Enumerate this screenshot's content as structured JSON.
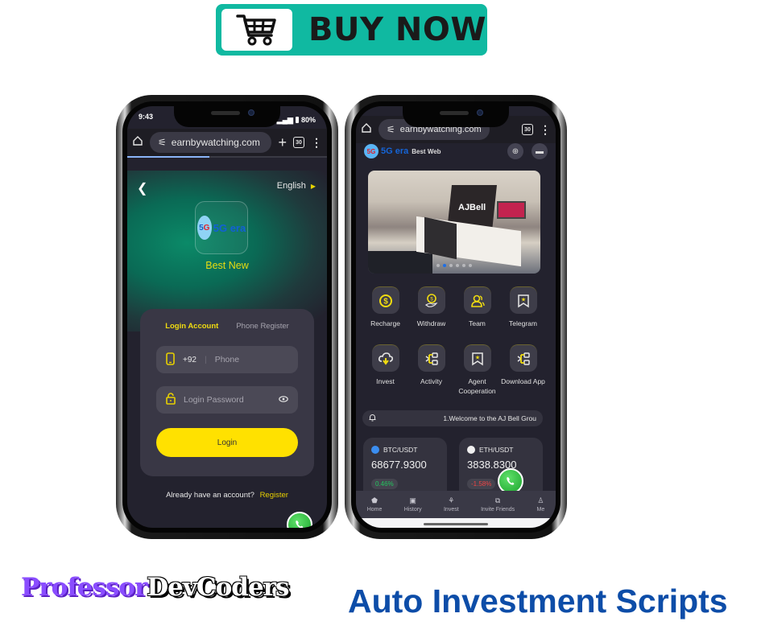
{
  "promo": {
    "buy_now_label": "BUY NOW",
    "buy_now_color": "#10b9a1"
  },
  "left_phone": {
    "status": {
      "time": "9:43",
      "battery": "80%"
    },
    "browser": {
      "url": "earnbywatching.com",
      "tab_count": "30",
      "new_tab": "+",
      "load_progress_percent": 41
    },
    "language": "English",
    "logo_text": "5G era",
    "logo_badge": "5G",
    "brand_name": "Best New",
    "tabs": {
      "login": "Login Account",
      "register": "Phone Register"
    },
    "phone_field": {
      "country_code": "+92",
      "placeholder": "Phone"
    },
    "password_field": {
      "placeholder": "Login Password"
    },
    "login_button": "Login",
    "register_prompt": "Already have an account?",
    "register_link": "Register"
  },
  "right_phone": {
    "browser": {
      "url": "earnbywatching.com",
      "tab_count": "30"
    },
    "header": {
      "brand": "5G era",
      "subtitle": "Best Web"
    },
    "banner": {
      "sign_text": "AJBell",
      "slide_count": 6,
      "active_slide": 2
    },
    "menu": [
      {
        "label": "Recharge",
        "icon": "recharge-icon"
      },
      {
        "label": "Withdraw",
        "icon": "withdraw-icon"
      },
      {
        "label": "Team",
        "icon": "team-icon"
      },
      {
        "label": "Telegram",
        "icon": "telegram-icon"
      },
      {
        "label": "Invest",
        "icon": "invest-icon"
      },
      {
        "label": "Activity",
        "icon": "activity-icon"
      },
      {
        "label": "Agent Cooperation",
        "icon": "agent-cooperation-icon"
      },
      {
        "label": "Download App",
        "icon": "download-app-icon"
      }
    ],
    "notice": "1.Welcome to the AJ Bell Grou",
    "tickers": [
      {
        "pair": "BTC/USDT",
        "price": "68677.9300",
        "change": "0.46%",
        "change_color": "#22c55e"
      },
      {
        "pair": "ETH/USDT",
        "price": "3838.8300",
        "change": "-1.58%",
        "change_color": "#ef4444"
      }
    ],
    "nav": [
      {
        "label": "Home",
        "icon": "home-icon"
      },
      {
        "label": "History",
        "icon": "history-icon"
      },
      {
        "label": "Invest",
        "icon": "invest-icon"
      },
      {
        "label": "Invite Friends",
        "icon": "invite-icon"
      },
      {
        "label": "Me",
        "icon": "user-icon"
      }
    ]
  },
  "footer": {
    "brand_part1": "Professor",
    "brand_part2": "DevCoders",
    "tagline": "Auto Investment Scripts"
  }
}
